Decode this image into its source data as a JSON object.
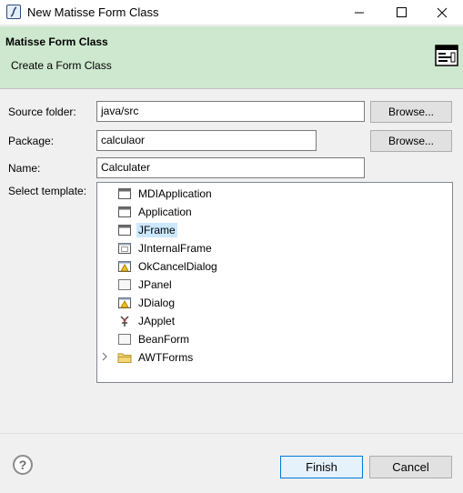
{
  "window": {
    "title": "New Matisse Form Class"
  },
  "header": {
    "title": "Matisse Form Class",
    "subtitle": "Create a Form Class"
  },
  "form": {
    "source_folder": {
      "label": "Source folder:",
      "value": "java/src",
      "browse": "Browse..."
    },
    "package": {
      "label": "Package:",
      "value": "calculaor",
      "browse": "Browse..."
    },
    "name": {
      "label": "Name:",
      "value": "Calculater"
    },
    "template": {
      "label": "Select template:"
    }
  },
  "templates": [
    {
      "label": "MDIApplication",
      "icon": "frame-icon",
      "selected": false
    },
    {
      "label": "Application",
      "icon": "frame-icon",
      "selected": false
    },
    {
      "label": "JFrame",
      "icon": "frame-icon",
      "selected": true
    },
    {
      "label": "JInternalFrame",
      "icon": "internal-frame-icon",
      "selected": false
    },
    {
      "label": "OkCancelDialog",
      "icon": "dialog-warning-icon",
      "selected": false
    },
    {
      "label": "JPanel",
      "icon": "panel-icon",
      "selected": false
    },
    {
      "label": "JDialog",
      "icon": "dialog-warning-icon",
      "selected": false
    },
    {
      "label": "JApplet",
      "icon": "applet-icon",
      "selected": false
    },
    {
      "label": "BeanForm",
      "icon": "bean-icon",
      "selected": false
    },
    {
      "label": "AWTForms",
      "icon": "folder-icon",
      "selected": false
    }
  ],
  "footer": {
    "finish": "Finish",
    "cancel": "Cancel",
    "help_icon": "?"
  },
  "colors": {
    "header_bg": "#cde8cf",
    "selection": "#cce8ff",
    "default_button_border": "#0078d7"
  }
}
